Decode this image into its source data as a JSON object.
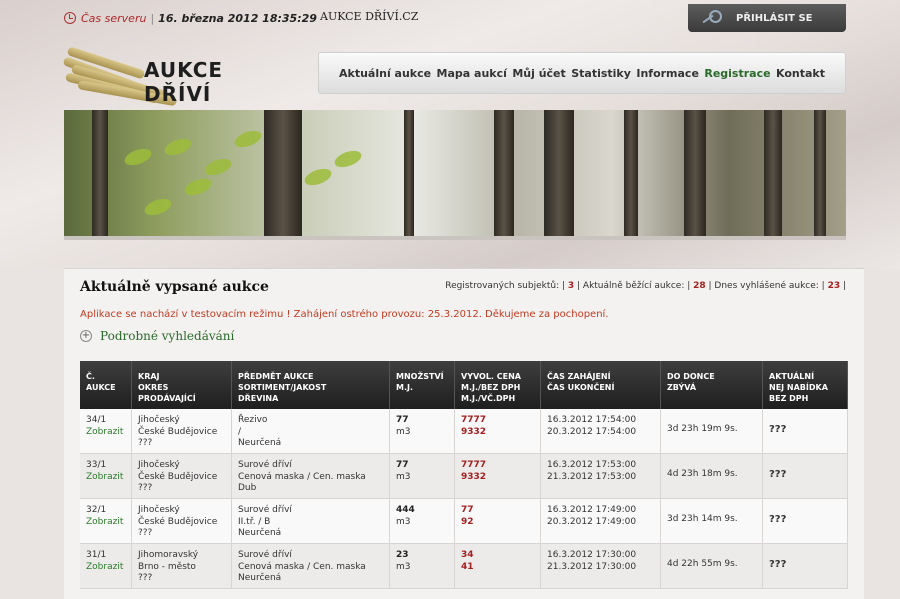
{
  "header": {
    "server_label": "Čas serveru",
    "server_separator": "|",
    "server_time": "16. března 2012 18:35:29",
    "site_name": "AUKCE DŘÍVÍ.CZ",
    "login_label": "PŘIHLÁSIT SE",
    "logo_text": "AUKCE DŘÍVÍ"
  },
  "nav": {
    "items": [
      "Aktuální aukce",
      "Mapa aukcí",
      "Můj účet",
      "Statistiky",
      "Informace",
      "Registrace",
      "Kontakt"
    ],
    "active": "Registrace"
  },
  "content": {
    "title": "Aktuálně vypsané aukce",
    "stats": {
      "registered_label": "Registrovaných subjektů:",
      "registered_value": "3",
      "running_label": "Aktuálně běžící aukce:",
      "running_value": "28",
      "today_label": "Dnes vyhlášené aukce:",
      "today_value": "23"
    },
    "notice": "Aplikace se nachází v testovacím režimu ! Zahájení ostrého provozu: 25.3.2012. Děkujeme za pochopení.",
    "advanced_search": "Podrobné vyhledávání"
  },
  "table": {
    "headers": [
      [
        "Č.",
        "AUKCE"
      ],
      [
        "KRAJ",
        "OKRES",
        "PRODÁVAJÍCÍ"
      ],
      [
        "PŘEDMĚT AUKCE",
        "SORTIMENT/JAKOST",
        "DŘEVINA"
      ],
      [
        "MNOŽSTVÍ",
        "M.J."
      ],
      [
        "VYVOL. CENA",
        "M.J./BEZ DPH",
        "M.J./VČ.DPH"
      ],
      [
        "ČAS ZAHÁJENÍ",
        "ČAS UKONČENÍ"
      ],
      [
        "DO DONCE",
        "ZBÝVÁ"
      ],
      [
        "AKTUÁLNÍ",
        "NEJ NABÍDKA",
        "BEZ DPH"
      ]
    ],
    "show_label": "Zobrazit",
    "rows": [
      {
        "id": "34/1",
        "region": [
          "Jihočeský",
          "České Budějovice",
          "???"
        ],
        "subject": [
          "Řezivo",
          "/",
          "Neurčená"
        ],
        "qty": "77",
        "unit": "m3",
        "price_net": "7777",
        "price_gross": "9332",
        "start": "16.3.2012 17:54:00",
        "end": "20.3.2012 17:54:00",
        "remaining": "3d 23h 19m 9s.",
        "bid": "???"
      },
      {
        "id": "33/1",
        "region": [
          "Jihočeský",
          "České Budějovice",
          "???"
        ],
        "subject": [
          "Surové dříví",
          "Cenová maska / Cen. maska",
          "Dub"
        ],
        "qty": "77",
        "unit": "m3",
        "price_net": "7777",
        "price_gross": "9332",
        "start": "16.3.2012 17:53:00",
        "end": "21.3.2012 17:53:00",
        "remaining": "4d 23h 18m 9s.",
        "bid": "???"
      },
      {
        "id": "32/1",
        "region": [
          "Jihočeský",
          "České Budějovice",
          "???"
        ],
        "subject": [
          "Surové dříví",
          "II.tř. / B",
          "Neurčená"
        ],
        "qty": "444",
        "unit": "m3",
        "price_net": "77",
        "price_gross": "92",
        "start": "16.3.2012 17:49:00",
        "end": "20.3.2012 17:49:00",
        "remaining": "3d 23h 14m 9s.",
        "bid": "???"
      },
      {
        "id": "31/1",
        "region": [
          "Jihomoravský",
          "Brno - město",
          "???"
        ],
        "subject": [
          "Surové dříví",
          "Cenová maska / Cen. maska",
          "Neurčená"
        ],
        "qty": "23",
        "unit": "m3",
        "price_net": "34",
        "price_gross": "41",
        "start": "16.3.2012 17:30:00",
        "end": "21.3.2012 17:30:00",
        "remaining": "4d 22h 55m 9s.",
        "bid": "???"
      }
    ]
  }
}
